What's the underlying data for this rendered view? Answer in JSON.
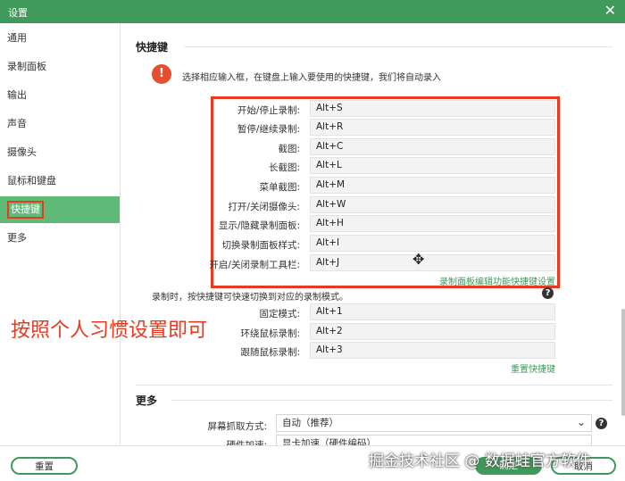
{
  "window": {
    "title": "设置",
    "close_glyph": "✕"
  },
  "sidebar": {
    "items": [
      {
        "label": "通用"
      },
      {
        "label": "录制面板"
      },
      {
        "label": "输出"
      },
      {
        "label": "声音"
      },
      {
        "label": "摄像头"
      },
      {
        "label": "鼠标和键盘"
      },
      {
        "label": "快捷键"
      },
      {
        "label": "更多"
      }
    ]
  },
  "hotkeys": {
    "title": "快捷键",
    "notice": "选择相应输入框，在键盘上输入要使用的快捷键，我们将自动录入",
    "rows": [
      {
        "label": "开始/停止录制:",
        "value": "Alt+S"
      },
      {
        "label": "暂停/继续录制:",
        "value": "Alt+R"
      },
      {
        "label": "截图:",
        "value": "Alt+C"
      },
      {
        "label": "长截图:",
        "value": "Alt+L"
      },
      {
        "label": "菜单截图:",
        "value": "Alt+M"
      },
      {
        "label": "打开/关闭摄像头:",
        "value": "Alt+W"
      },
      {
        "label": "显示/隐藏录制面板:",
        "value": "Alt+H"
      },
      {
        "label": "切换录制面板样式:",
        "value": "Alt+I"
      },
      {
        "label": "开启/关闭录制工具栏:",
        "value": "Alt+J"
      }
    ],
    "panel_link": "录制面板编辑功能快捷键设置",
    "mode_desc": "录制时，按快捷键可快速切换到对应的录制模式。",
    "mode_rows": [
      {
        "label": "固定模式:",
        "value": "Alt+1"
      },
      {
        "label": "环绕鼠标录制:",
        "value": "Alt+2"
      },
      {
        "label": "跟随鼠标录制:",
        "value": "Alt+3"
      }
    ],
    "reset_link": "重置快捷键"
  },
  "more": {
    "title": "更多",
    "capture_label": "屏幕抓取方式:",
    "capture_value": "自动（推荐）",
    "hw_label": "硬件加速:",
    "hw_value": "显卡加速（硬件编码）"
  },
  "annotation": "按照个人习惯设置即可",
  "footer": {
    "reset": "重置",
    "ok": "确定",
    "cancel": "取消",
    "watermark": "掘金技术社区 @ 数据蛙官方软件"
  }
}
